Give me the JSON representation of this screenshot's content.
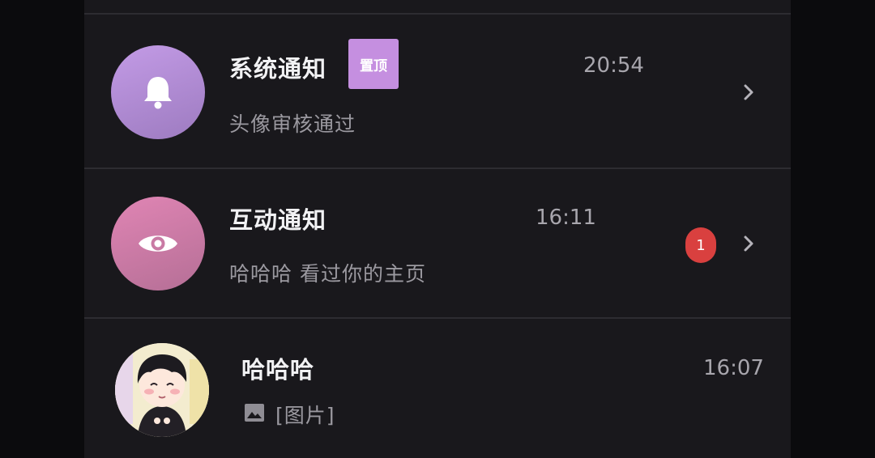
{
  "notifications": [
    {
      "icon": "bell-icon",
      "title": "系统通知",
      "pin_label": "置顶",
      "time": "20:54",
      "preview": "头像审核通过",
      "colors": {
        "avatar_top": "#c39be6",
        "avatar_bottom": "#9d7bc0",
        "pin_bg": "#c58fe0"
      }
    },
    {
      "icon": "eye-icon",
      "title": "互动通知",
      "time": "16:11",
      "preview": "哈哈哈 看过你的主页",
      "unread_count": "1",
      "colors": {
        "avatar_top": "#e085b4",
        "avatar_bottom": "#b56f96",
        "badge": "#d9403f"
      }
    }
  ],
  "chats": [
    {
      "avatar": "cartoon-boy-avatar",
      "name": "哈哈哈",
      "time": "16:07",
      "preview_icon": "image-icon",
      "preview": "[图片]"
    }
  ],
  "colors": {
    "background": "#19181c",
    "divider": "#2d2c31",
    "title": "#f2f2f4",
    "subtitle": "#9b99a0"
  }
}
